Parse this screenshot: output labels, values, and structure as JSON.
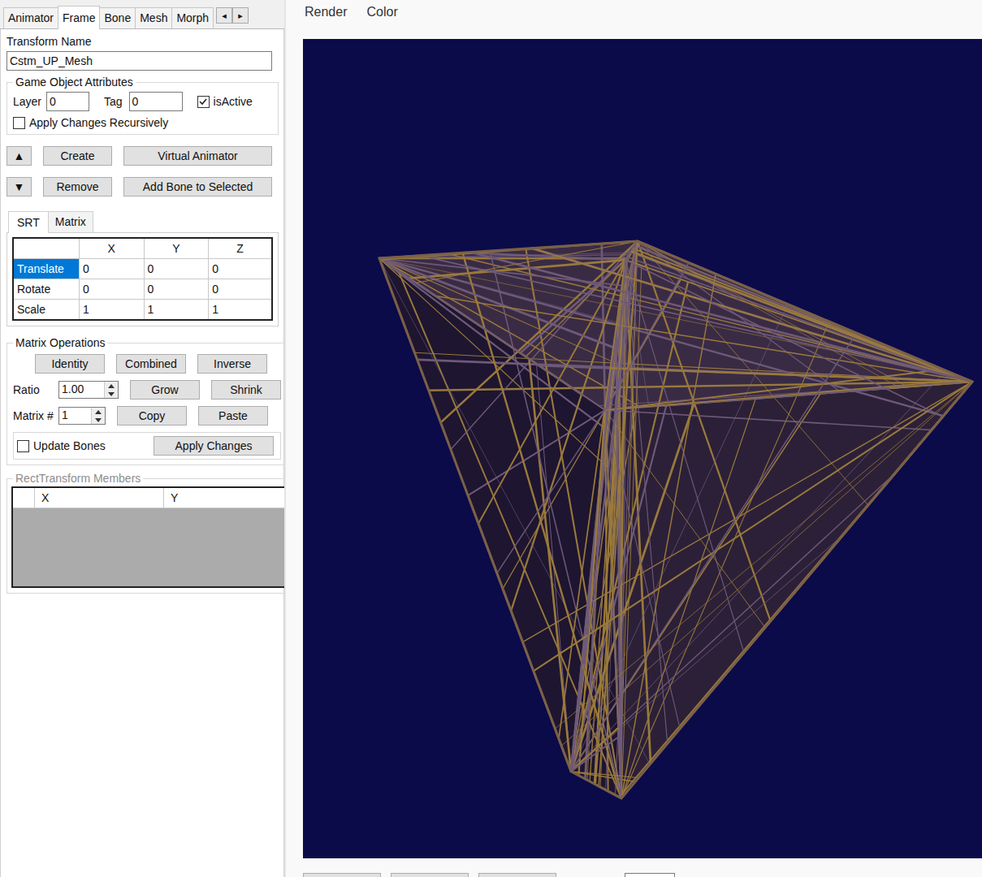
{
  "tabs": [
    {
      "label": "Animator",
      "selected": false
    },
    {
      "label": "Frame",
      "selected": true
    },
    {
      "label": "Bone",
      "selected": false
    },
    {
      "label": "Mesh",
      "selected": false
    },
    {
      "label": "Morph",
      "selected": false
    }
  ],
  "tab_scroll": [
    "◂",
    "▸"
  ],
  "transform_name": {
    "label": "Transform Name",
    "value": "Cstm_UP_Mesh"
  },
  "game_object": {
    "title": "Game Object Attributes",
    "layer": {
      "label": "Layer",
      "value": "0"
    },
    "tag": {
      "label": "Tag",
      "value": "0"
    },
    "is_active": {
      "label": "isActive",
      "checked": true
    },
    "recursive": {
      "label": "Apply Changes Recursively",
      "checked": false
    }
  },
  "frame_buttons": [
    {
      "icon": "▲",
      "buttons": [
        "Create",
        "Virtual Animator"
      ]
    },
    {
      "icon": "▼",
      "buttons": [
        "Remove",
        "Add Bone to Selected"
      ]
    }
  ],
  "sub_tabs": [
    {
      "label": "SRT",
      "selected": true
    },
    {
      "label": "Matrix",
      "selected": false
    }
  ],
  "srt_grid": {
    "columns": [
      "X",
      "Y",
      "Z"
    ],
    "rows": [
      {
        "label": "Translate",
        "values": [
          "0",
          "0",
          "0"
        ],
        "selected": true
      },
      {
        "label": "Rotate",
        "values": [
          "0",
          "0",
          "0"
        ],
        "selected": false
      },
      {
        "label": "Scale",
        "values": [
          "1",
          "1",
          "1"
        ],
        "selected": false
      }
    ]
  },
  "matrix_ops": {
    "title": "Matrix Operations",
    "row1": [
      "Identity",
      "Combined",
      "Inverse"
    ],
    "ratio": {
      "label": "Ratio",
      "value": "1.00"
    },
    "row2": [
      "Grow",
      "Shrink"
    ],
    "matrix_num": {
      "label": "Matrix #",
      "value": "1"
    },
    "row3": [
      "Copy",
      "Paste"
    ],
    "update_bones": {
      "label": "Update Bones",
      "checked": false
    },
    "apply": "Apply Changes"
  },
  "rect_transform": {
    "title": "RectTransform Members",
    "disabled": true,
    "columns": [
      "X",
      "Y"
    ]
  },
  "menu": [
    "Render",
    "Color"
  ]
}
